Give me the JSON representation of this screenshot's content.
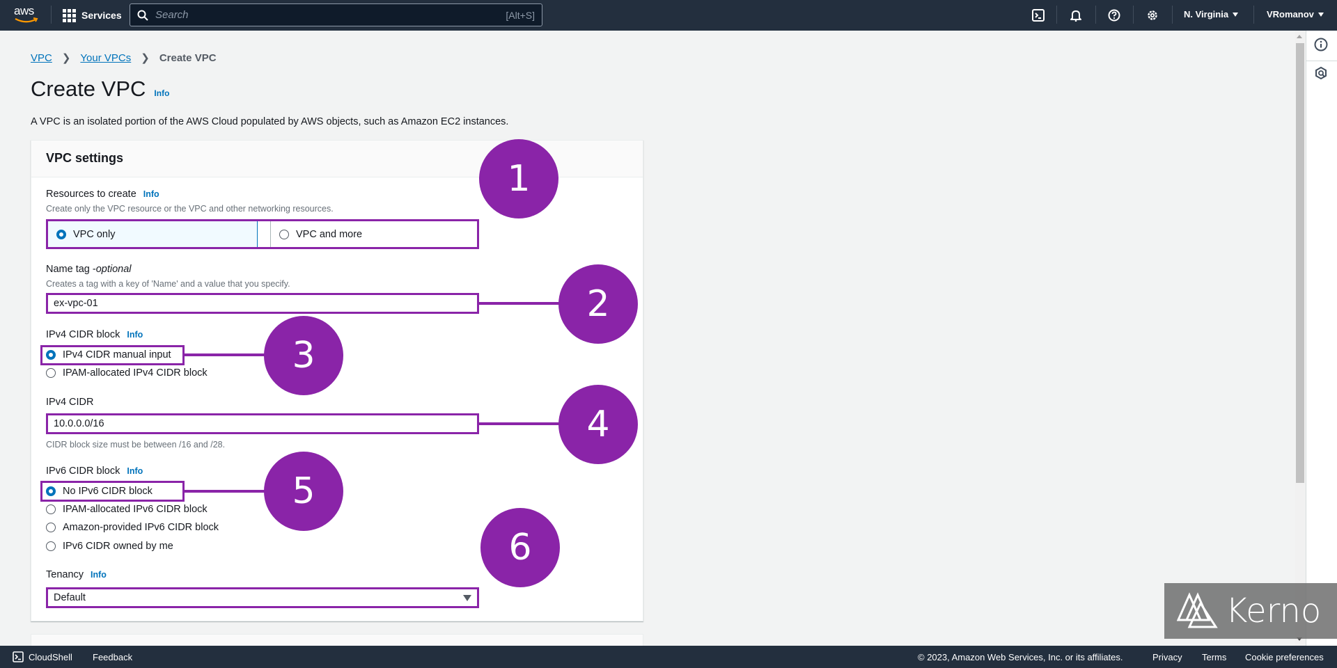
{
  "topnav": {
    "logo": "aws",
    "services_label": "Services",
    "search_placeholder": "Search",
    "search_shortcut": "[Alt+S]",
    "icons": [
      "cloudshell-icon",
      "bell-icon",
      "help-icon",
      "settings-icon"
    ],
    "region": "N. Virginia",
    "user": "VRomanov"
  },
  "breadcrumb": [
    {
      "label": "VPC",
      "link": true
    },
    {
      "label": "Your VPCs",
      "link": true
    },
    {
      "label": "Create VPC",
      "link": false
    }
  ],
  "page": {
    "title": "Create VPC",
    "info": "Info",
    "description": "A VPC is an isolated portion of the AWS Cloud populated by AWS objects, such as Amazon EC2 instances."
  },
  "vpc_settings": {
    "heading": "VPC settings",
    "resources": {
      "label": "Resources to create",
      "info": "Info",
      "hint": "Create only the VPC resource or the VPC and other networking resources.",
      "options": [
        {
          "label": "VPC only",
          "selected": true
        },
        {
          "label": "VPC and more",
          "selected": false
        }
      ]
    },
    "name_tag": {
      "label": "Name tag - ",
      "label_optional": "optional",
      "hint": "Creates a tag with a key of 'Name' and a value that you specify.",
      "value": "ex-vpc-01"
    },
    "ipv4_block": {
      "label": "IPv4 CIDR block",
      "info": "Info",
      "options": [
        {
          "label": "IPv4 CIDR manual input",
          "selected": true
        },
        {
          "label": "IPAM-allocated IPv4 CIDR block",
          "selected": false
        }
      ]
    },
    "ipv4_cidr": {
      "label": "IPv4 CIDR",
      "value": "10.0.0.0/16",
      "hint": "CIDR block size must be between /16 and /28."
    },
    "ipv6_block": {
      "label": "IPv6 CIDR block",
      "info": "Info",
      "options": [
        {
          "label": "No IPv6 CIDR block",
          "selected": true
        },
        {
          "label": "IPAM-allocated IPv6 CIDR block",
          "selected": false
        },
        {
          "label": "Amazon-provided IPv6 CIDR block",
          "selected": false
        },
        {
          "label": "IPv6 CIDR owned by me",
          "selected": false
        }
      ]
    },
    "tenancy": {
      "label": "Tenancy",
      "info": "Info",
      "value": "Default"
    }
  },
  "annotations": [
    "1",
    "2",
    "3",
    "4",
    "5",
    "6"
  ],
  "annotation_color": "#8a24a8",
  "watermark": "Kerno",
  "footer": {
    "cloudshell": "CloudShell",
    "feedback": "Feedback",
    "copyright": "© 2023, Amazon Web Services, Inc. or its affiliates.",
    "privacy": "Privacy",
    "terms": "Terms",
    "cookies": "Cookie preferences"
  }
}
